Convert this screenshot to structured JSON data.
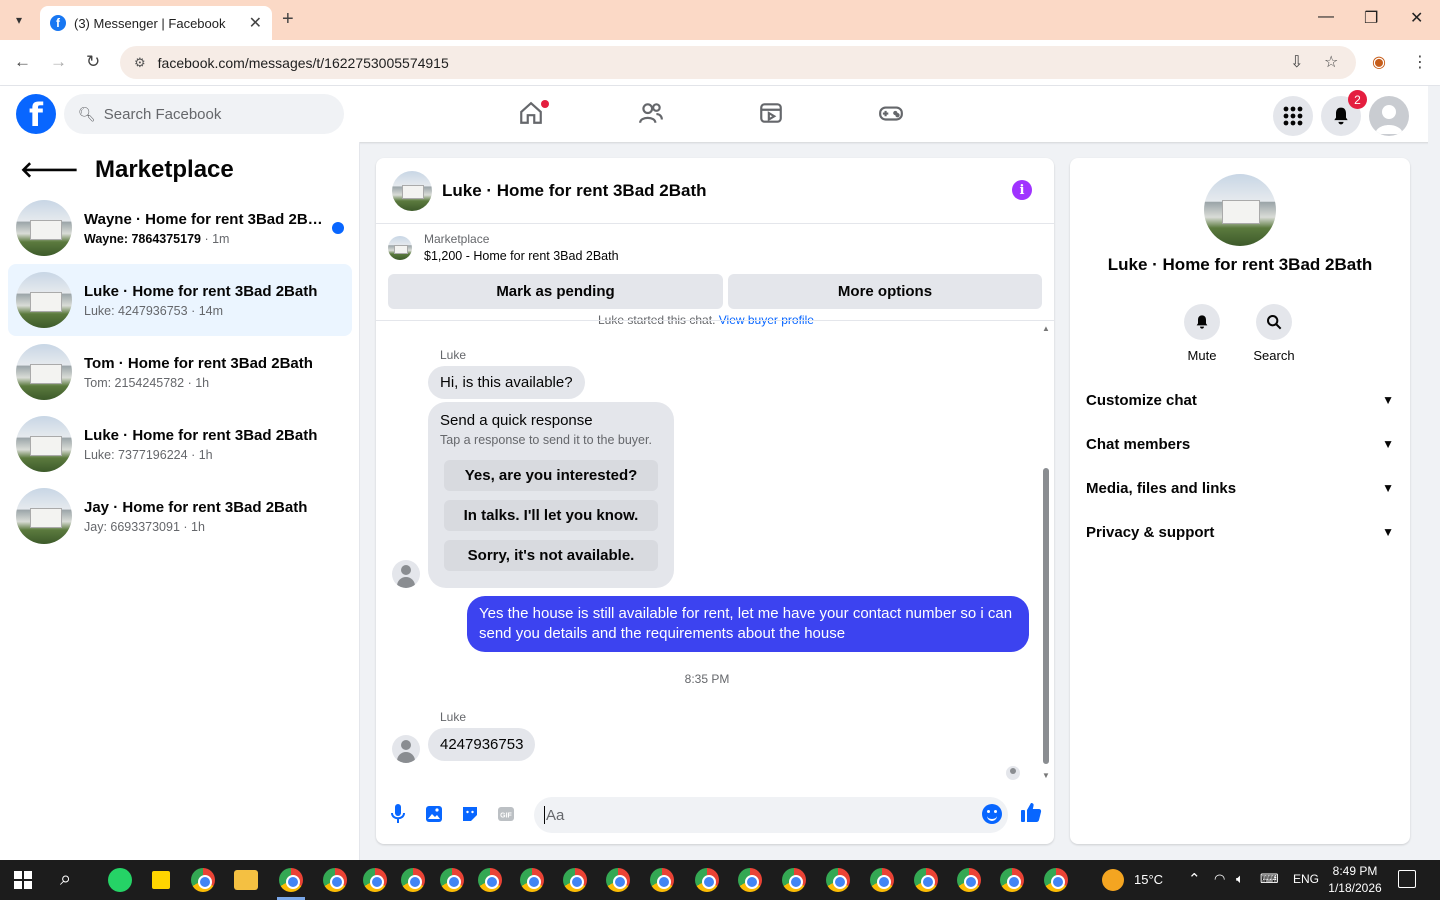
{
  "browser": {
    "tab_title": "(3) Messenger | Facebook",
    "url": "facebook.com/messages/t/1622753005574915"
  },
  "fb": {
    "search_placeholder": "Search Facebook",
    "notification_count": "2"
  },
  "sidebar": {
    "title": "Marketplace",
    "conversations": [
      {
        "title": "Wayne · Home for rent 3Bad 2Ba...",
        "subtitle": "Wayne: 7864375179",
        "time": "· 1m",
        "unread": true
      },
      {
        "title": "Luke · Home for rent 3Bad 2Bath",
        "subtitle": "Luke: 4247936753",
        "time": "· 14m",
        "active": true
      },
      {
        "title": "Tom · Home for rent 3Bad 2Bath",
        "subtitle": "Tom: 2154245782",
        "time": "· 1h"
      },
      {
        "title": "Luke · Home for rent 3Bad 2Bath",
        "subtitle": "Luke: 7377196224",
        "time": "· 1h"
      },
      {
        "title": "Jay · Home for rent 3Bad 2Bath",
        "subtitle": "Jay: 6693373091",
        "time": "· 1h"
      }
    ]
  },
  "chat": {
    "title": "Luke · Home for rent 3Bad 2Bath",
    "marketplace_label": "Marketplace",
    "listing": "$1,200 - Home for rent 3Bad 2Bath",
    "mark_pending": "Mark as pending",
    "more_options": "More options",
    "started_text": "Luke started this chat.",
    "view_profile": "View buyer profile",
    "sender_name": "Luke",
    "msg_in_1": "Hi, is this available?",
    "quick_title": "Send a quick response",
    "quick_sub": "Tap a response to send it to the buyer.",
    "quick_options": [
      "Yes, are you interested?",
      "In talks. I'll let you know.",
      "Sorry, it's not available."
    ],
    "msg_out_1": "Yes the house is still available for rent, let me have your contact number so i can send you details and the requirements about the house",
    "timestamp": "8:35 PM",
    "msg_in_2": "4247936753",
    "composer_placeholder": "Aa"
  },
  "info": {
    "title": "Luke · Home for rent 3Bad 2Bath",
    "actions": [
      "Mute",
      "Search"
    ],
    "sections": [
      "Customize chat",
      "Chat members",
      "Media, files and links",
      "Privacy & support"
    ]
  },
  "taskbar": {
    "temperature": "15°C",
    "language": "ENG",
    "time": "8:49 PM",
    "date": "1/18/2026"
  },
  "colors": {
    "fb_blue": "#0866ff",
    "outgoing_bubble": "#3c43f0",
    "active_conversation": "#ebf5ff"
  }
}
